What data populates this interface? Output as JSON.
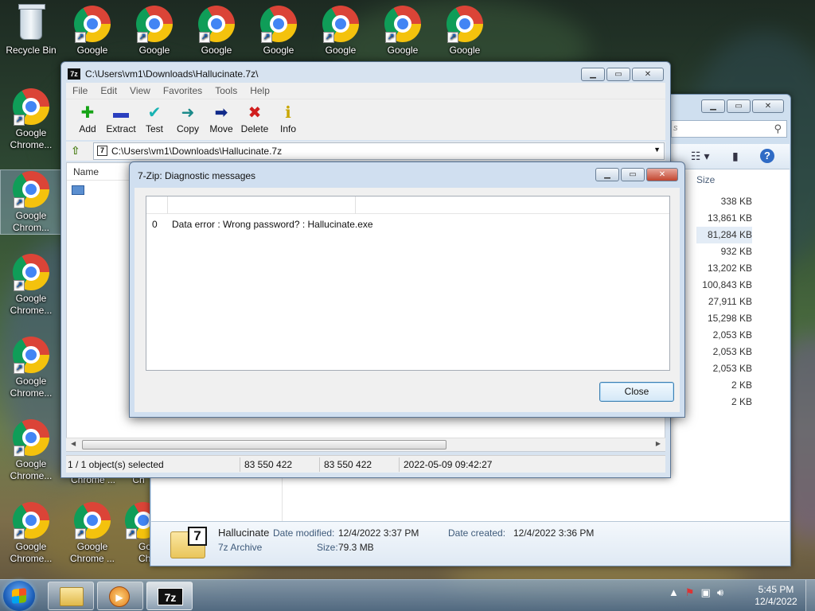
{
  "desktop": {
    "recycle_bin": "Recycle Bin",
    "top_row": [
      "Google",
      "Google",
      "Google",
      "Google",
      "Google",
      "Google",
      "Google"
    ],
    "left_column": [
      "Google\nChrome...",
      "Google\nChrom...",
      "Google\nChrome...",
      "Google\nChrome...",
      "Google\nChrome...",
      "Google\nChrome..."
    ],
    "bottom_extra": [
      "Google\nChrome ...",
      "Go\nChr"
    ],
    "behind_labels": [
      "Chrome ...",
      "Ch"
    ]
  },
  "explorer": {
    "search_placeholder": "s",
    "size_header": "Size",
    "sizes": [
      "338 KB",
      "13,861 KB",
      "81,284 KB",
      "932 KB",
      "13,202 KB",
      "100,843 KB",
      "27,911 KB",
      "15,298 KB",
      "2,053 KB",
      "2,053 KB",
      "2,053 KB",
      "2 KB",
      "2 KB"
    ],
    "details": {
      "name": "Hallucinate",
      "type": "7z Archive",
      "modified_label": "Date modified:",
      "modified_value": "12/4/2022 3:37 PM",
      "created_label": "Date created:",
      "created_value": "12/4/2022 3:36 PM",
      "size_label": "Size:",
      "size_value": "79.3 MB"
    }
  },
  "sevenzip": {
    "title": "C:\\Users\\vm1\\Downloads\\Hallucinate.7z\\",
    "menu": [
      "File",
      "Edit",
      "View",
      "Favorites",
      "Tools",
      "Help"
    ],
    "toolbar": [
      {
        "label": "Add",
        "icon": "plus-icon",
        "glyph": "✚",
        "color": "#16a316"
      },
      {
        "label": "Extract",
        "icon": "minus-icon",
        "glyph": "▬",
        "color": "#2b3fbf"
      },
      {
        "label": "Test",
        "icon": "check-icon",
        "glyph": "✔",
        "color": "#19b3b3"
      },
      {
        "label": "Copy",
        "icon": "copy-arrows-icon",
        "glyph": "➜",
        "color": "#1b8a8a"
      },
      {
        "label": "Move",
        "icon": "arrow-right-icon",
        "glyph": "➡",
        "color": "#102a8a"
      },
      {
        "label": "Delete",
        "icon": "x-icon",
        "glyph": "✖",
        "color": "#d01e1e"
      },
      {
        "label": "Info",
        "icon": "info-icon",
        "glyph": "ℹ",
        "color": "#c9a600"
      }
    ],
    "address": "C:\\Users\\vm1\\Downloads\\Hallucinate.7z",
    "column_name": "Name",
    "status": {
      "selected": "1 / 1 object(s) selected",
      "size1": "83 550 422",
      "size2": "83 550 422",
      "date": "2022-05-09 09:42:27"
    }
  },
  "dialog": {
    "title": "7-Zip: Diagnostic messages",
    "rows": [
      {
        "index": "0",
        "message": "Data error : Wrong password? : Hallucinate.exe"
      }
    ],
    "close_label": "Close"
  },
  "taskbar": {
    "apps": [
      "file-explorer",
      "media-player",
      "7-zip"
    ],
    "time": "5:45 PM",
    "date": "12/4/2022"
  }
}
